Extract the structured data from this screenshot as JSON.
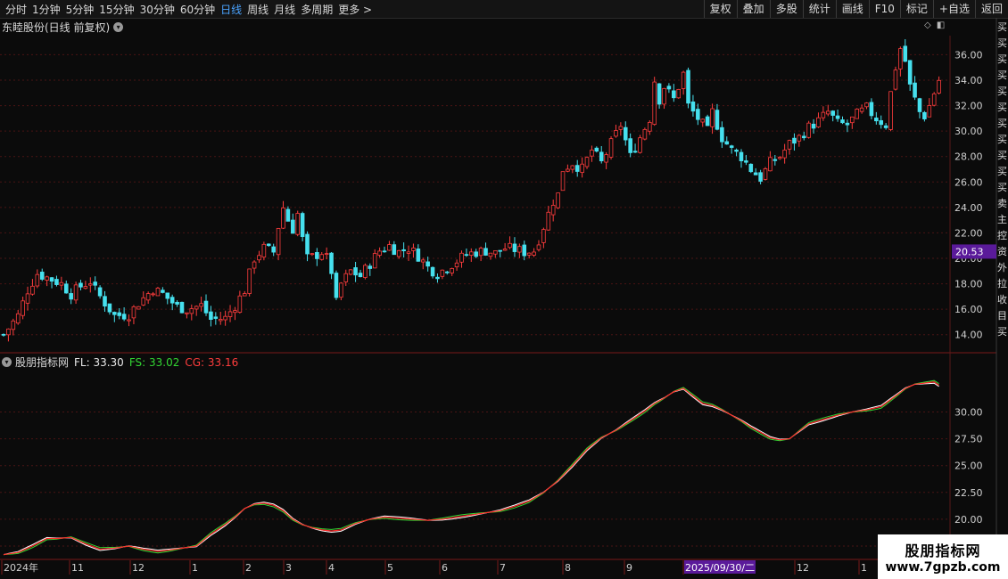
{
  "toolbar": {
    "timeframes": [
      "分时",
      "1分钟",
      "5分钟",
      "15分钟",
      "30分钟",
      "60分钟",
      "日线",
      "周线",
      "月线",
      "多周期",
      "更多 >"
    ],
    "active": 6,
    "tools": [
      "复权",
      "叠加",
      "多股",
      "统计",
      "画线",
      "F10",
      "标记",
      "+自选",
      "返回"
    ]
  },
  "main": {
    "title": "东睦股份(日线 前复权)",
    "price_tag": "20.53"
  },
  "indicator": {
    "name": "股朋指标网",
    "fl": "FL: 33.30",
    "fs": "FS: 33.02",
    "cg": "CG: 33.16"
  },
  "right_labels": [
    "买",
    "买",
    "买",
    "买",
    "买",
    "买",
    "买",
    "买",
    "买",
    "买",
    "买",
    "卖",
    "主",
    "控",
    "资",
    "外",
    "拉",
    "收",
    "目",
    "买"
  ],
  "watermark": {
    "title": "股朋指标网",
    "url": "www.7gpzb.com"
  },
  "colors": {
    "up": "#ff3d3d",
    "down": "#46e0ee",
    "fl": "#ffffff",
    "fs": "#33d633",
    "cg": "#ff2a2a",
    "active_tab": "#4aa3ff",
    "tag": "#5a1a9a"
  },
  "chart_data": [
    {
      "type": "candlestick",
      "title": "东睦股份(日线 前复权)",
      "ylim": [
        13,
        37.5
      ],
      "y_ticks": [
        "14.00",
        "16.00",
        "18.00",
        "20.00",
        "22.00",
        "24.00",
        "26.00",
        "28.00",
        "30.00",
        "32.00",
        "34.00",
        "36.00"
      ],
      "x_labels": [
        "2024年",
        "11",
        "12",
        "1",
        "2",
        "3",
        "4",
        "5",
        "6",
        "7",
        "8",
        "9",
        "2025/09/30/二",
        "12",
        "1"
      ],
      "close_path": [
        [
          0,
          14.0
        ],
        [
          3,
          15.5
        ],
        [
          5,
          17.5
        ],
        [
          7,
          18.8
        ],
        [
          9,
          18.5
        ],
        [
          12,
          18.0
        ],
        [
          14,
          17.2
        ],
        [
          16,
          17.8
        ],
        [
          18,
          18.2
        ],
        [
          19,
          17.5
        ],
        [
          21,
          16.5
        ],
        [
          23,
          15.5
        ],
        [
          26,
          15.6
        ],
        [
          28,
          16.5
        ],
        [
          31,
          17.6
        ],
        [
          33,
          17.2
        ],
        [
          36,
          16.2
        ],
        [
          38,
          16.0
        ],
        [
          41,
          16.3
        ],
        [
          43,
          15.2
        ],
        [
          46,
          15.3
        ],
        [
          48,
          16.3
        ],
        [
          50,
          17.5
        ],
        [
          52,
          20.0
        ],
        [
          54,
          20.8
        ],
        [
          56,
          20.5
        ],
        [
          57,
          22.5
        ],
        [
          58,
          24.0
        ],
        [
          59,
          23.0
        ],
        [
          60,
          22.3
        ],
        [
          61,
          23.5
        ],
        [
          62,
          21.5
        ],
        [
          63,
          20.0
        ],
        [
          64,
          20.1
        ],
        [
          66,
          20.5
        ],
        [
          67,
          20.0
        ],
        [
          68,
          19.0
        ],
        [
          69,
          16.5
        ],
        [
          70,
          18.0
        ],
        [
          72,
          19.0
        ],
        [
          74,
          18.6
        ],
        [
          76,
          19.6
        ],
        [
          78,
          20.6
        ],
        [
          80,
          21.0
        ],
        [
          82,
          20.5
        ],
        [
          84,
          20.8
        ],
        [
          86,
          20.2
        ],
        [
          88,
          19.3
        ],
        [
          90,
          18.8
        ],
        [
          92,
          19.3
        ],
        [
          94,
          19.8
        ],
        [
          96,
          20.3
        ],
        [
          98,
          20.5
        ],
        [
          100,
          20.6
        ],
        [
          102,
          20.4
        ],
        [
          104,
          20.8
        ],
        [
          106,
          20.7
        ],
        [
          108,
          20.5
        ],
        [
          110,
          20.6
        ],
        [
          111,
          21.5
        ],
        [
          113,
          23.5
        ],
        [
          114,
          24.5
        ],
        [
          115,
          25.0
        ],
        [
          116,
          27.0
        ],
        [
          118,
          27.5
        ],
        [
          120,
          27.0
        ],
        [
          122,
          28.5
        ],
        [
          124,
          27.5
        ],
        [
          126,
          29.0
        ],
        [
          128,
          30.5
        ],
        [
          130,
          28.0
        ],
        [
          132,
          29.5
        ],
        [
          134,
          31.0
        ],
        [
          135,
          34.0
        ],
        [
          136,
          32.5
        ],
        [
          137,
          33.5
        ],
        [
          139,
          32.5
        ],
        [
          141,
          34.5
        ],
        [
          142,
          32.0
        ],
        [
          144,
          31.0
        ],
        [
          146,
          30.0
        ],
        [
          147,
          31.5
        ],
        [
          149,
          29.5
        ],
        [
          151,
          28.5
        ],
        [
          153,
          28.0
        ],
        [
          155,
          27.0
        ],
        [
          157,
          26.3
        ],
        [
          159,
          27.5
        ],
        [
          161,
          28.0
        ],
        [
          163,
          29.0
        ],
        [
          165,
          29.5
        ],
        [
          167,
          30.3
        ],
        [
          169,
          30.8
        ],
        [
          171,
          31.5
        ],
        [
          173,
          30.6
        ],
        [
          175,
          30.5
        ],
        [
          177,
          31.3
        ],
        [
          179,
          31.8
        ],
        [
          181,
          31.0
        ],
        [
          183,
          30.5
        ],
        [
          184,
          33.0
        ],
        [
          185,
          35.0
        ],
        [
          186,
          36.5
        ],
        [
          187,
          35.5
        ],
        [
          188,
          33.5
        ],
        [
          189,
          32.5
        ],
        [
          190,
          31.5
        ],
        [
          191,
          31.2
        ],
        [
          192,
          32.0
        ],
        [
          193,
          33.0
        ],
        [
          194,
          34.0
        ]
      ]
    },
    {
      "type": "line",
      "ylim": [
        16.5,
        34.2
      ],
      "y_ticks": [
        "17.50",
        "20.00",
        "22.50",
        "25.00",
        "27.50",
        "30.00"
      ],
      "series": [
        {
          "name": "FL",
          "color": "#ffffff",
          "points": [
            [
              0,
              16.7
            ],
            [
              3,
              16.9
            ],
            [
              6,
              17.5
            ],
            [
              9,
              18.2
            ],
            [
              11,
              18.2
            ],
            [
              14,
              18.3
            ],
            [
              17,
              17.7
            ],
            [
              20,
              17.2
            ],
            [
              23,
              17.3
            ],
            [
              26,
              17.5
            ],
            [
              29,
              17.2
            ],
            [
              32,
              17.0
            ],
            [
              34,
              17.1
            ],
            [
              37,
              17.3
            ],
            [
              40,
              17.5
            ],
            [
              43,
              18.6
            ],
            [
              46,
              19.5
            ],
            [
              48,
              20.2
            ],
            [
              50,
              21.0
            ],
            [
              52,
              21.4
            ],
            [
              54,
              21.5
            ],
            [
              56,
              21.3
            ],
            [
              58,
              20.8
            ],
            [
              60,
              20.0
            ],
            [
              62,
              19.5
            ],
            [
              64,
              19.2
            ],
            [
              66,
              19.0
            ],
            [
              68,
              18.9
            ],
            [
              70,
              19.0
            ],
            [
              73,
              19.6
            ],
            [
              76,
              20.0
            ],
            [
              79,
              20.2
            ],
            [
              82,
              20.1
            ],
            [
              85,
              20.0
            ],
            [
              88,
              19.9
            ],
            [
              91,
              20.0
            ],
            [
              94,
              20.2
            ],
            [
              97,
              20.4
            ],
            [
              100,
              20.6
            ],
            [
              103,
              20.8
            ],
            [
              106,
              21.2
            ],
            [
              109,
              21.7
            ],
            [
              112,
              22.5
            ],
            [
              115,
              23.6
            ],
            [
              118,
              25.0
            ],
            [
              121,
              26.5
            ],
            [
              124,
              27.6
            ],
            [
              127,
              28.3
            ],
            [
              130,
              29.2
            ],
            [
              133,
              30.1
            ],
            [
              135,
              30.8
            ],
            [
              137,
              31.3
            ],
            [
              139,
              31.9
            ],
            [
              141,
              32.2
            ],
            [
              143,
              31.5
            ],
            [
              145,
              30.8
            ],
            [
              147,
              30.6
            ],
            [
              149,
              30.2
            ],
            [
              151,
              29.7
            ],
            [
              153,
              29.2
            ],
            [
              155,
              28.6
            ],
            [
              157,
              28.1
            ],
            [
              159,
              27.6
            ],
            [
              161,
              27.4
            ],
            [
              163,
              27.5
            ],
            [
              165,
              28.2
            ],
            [
              167,
              28.9
            ],
            [
              170,
              29.3
            ],
            [
              173,
              29.7
            ],
            [
              176,
              30.0
            ],
            [
              179,
              30.2
            ],
            [
              182,
              30.5
            ],
            [
              185,
              31.5
            ],
            [
              187,
              32.2
            ],
            [
              189,
              32.6
            ],
            [
              191,
              32.7
            ],
            [
              193,
              32.8
            ],
            [
              194,
              32.5
            ]
          ]
        },
        {
          "name": "FS",
          "color": "#33d633",
          "offset": -0.15
        },
        {
          "name": "CG",
          "color": "#ff2a2a",
          "offset": 0.0
        }
      ]
    }
  ]
}
